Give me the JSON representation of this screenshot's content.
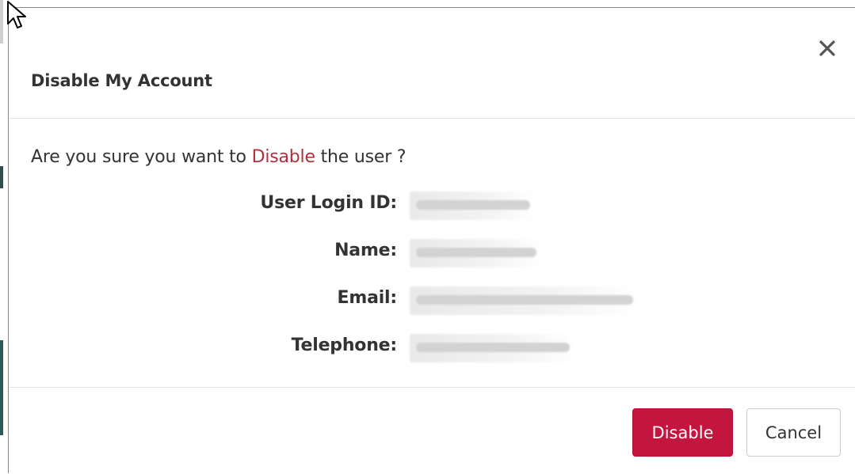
{
  "dialog": {
    "title": "Disable My Account",
    "close_label": "×"
  },
  "body": {
    "question_prefix": "Are you sure you want to ",
    "question_action": "Disable",
    "question_suffix": " the user ?",
    "details": [
      {
        "label": "User Login ID:",
        "value": ""
      },
      {
        "label": "Name:",
        "value": ""
      },
      {
        "label": "Email:",
        "value": ""
      },
      {
        "label": "Telephone:",
        "value": ""
      }
    ]
  },
  "footer": {
    "disable_label": "Disable",
    "cancel_label": "Cancel"
  },
  "colors": {
    "primary_button": "#c4153f",
    "warning_text": "#b0303a"
  },
  "icons": {
    "close": "close-icon",
    "cursor": "mouse-pointer-icon"
  }
}
